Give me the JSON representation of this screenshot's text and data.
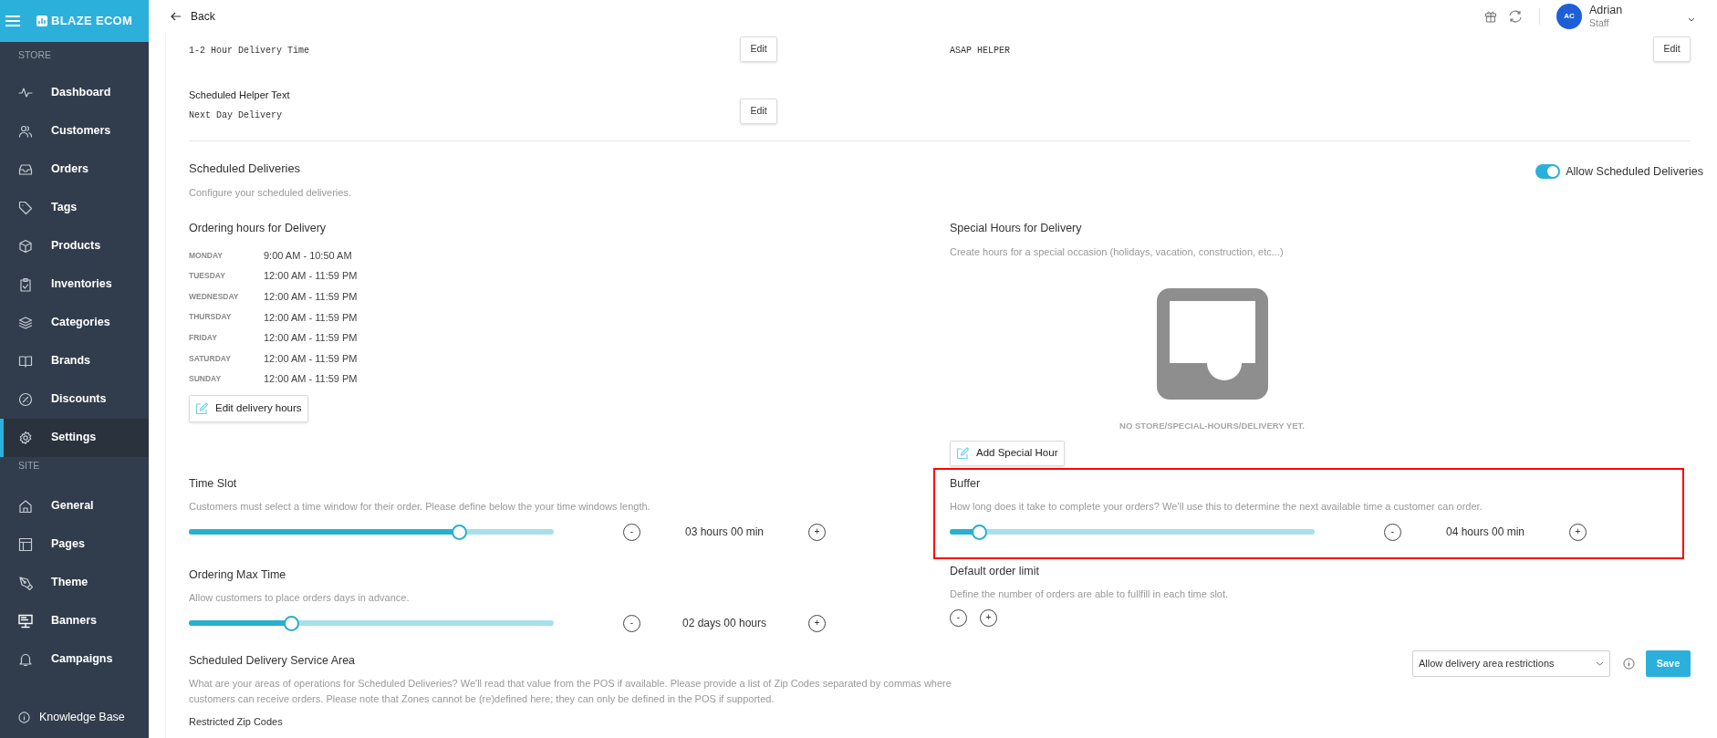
{
  "brand": {
    "name": "BLAZE ECOM"
  },
  "sidebar": {
    "sections": [
      {
        "label": "STORE",
        "items": [
          {
            "label": "Dashboard",
            "selected": false
          },
          {
            "label": "Customers",
            "selected": false
          },
          {
            "label": "Orders",
            "selected": false
          },
          {
            "label": "Tags",
            "selected": false
          },
          {
            "label": "Products",
            "selected": false
          },
          {
            "label": "Inventories",
            "selected": false
          },
          {
            "label": "Categories",
            "selected": false
          },
          {
            "label": "Brands",
            "selected": false
          },
          {
            "label": "Discounts",
            "selected": false
          },
          {
            "label": "Settings",
            "selected": true
          }
        ]
      },
      {
        "label": "SITE",
        "items": [
          {
            "label": "General",
            "selected": false
          },
          {
            "label": "Pages",
            "selected": false
          },
          {
            "label": "Theme",
            "selected": false
          },
          {
            "label": "Banners",
            "selected": false
          },
          {
            "label": "Campaigns",
            "selected": false
          }
        ]
      }
    ],
    "footer": {
      "label": "Knowledge Base"
    }
  },
  "header": {
    "back": "Back",
    "user": {
      "initials": "AC",
      "name": "Adrian",
      "role": "Staff"
    }
  },
  "helper_fields": [
    {
      "value": "1-2 Hour Delivery Time",
      "button": "Edit"
    },
    {
      "value": "ASAP HELPER",
      "button": "Edit"
    },
    {
      "label": "Scheduled Helper Text",
      "value": "Next Day Delivery",
      "button": "Edit"
    }
  ],
  "scheduled": {
    "title": "Scheduled Deliveries",
    "description": "Configure your scheduled deliveries.",
    "toggle": {
      "label": "Allow Scheduled Deliveries",
      "on": true
    }
  },
  "ordering_hours": {
    "title": "Ordering hours for Delivery",
    "rows": [
      {
        "day": "MONDAY",
        "hours": "9:00 AM - 10:50 AM"
      },
      {
        "day": "TUESDAY",
        "hours": "12:00 AM - 11:59 PM"
      },
      {
        "day": "WEDNESDAY",
        "hours": "12:00 AM - 11:59 PM"
      },
      {
        "day": "THURSDAY",
        "hours": "12:00 AM - 11:59 PM"
      },
      {
        "day": "FRIDAY",
        "hours": "12:00 AM - 11:59 PM"
      },
      {
        "day": "SATURDAY",
        "hours": "12:00 AM - 11:59 PM"
      },
      {
        "day": "SUNDAY",
        "hours": "12:00 AM - 11:59 PM"
      }
    ],
    "button": "Edit delivery hours"
  },
  "special_hours": {
    "title": "Special Hours for Delivery",
    "description": "Create hours for a special occasion (holidays, vacation, construction, etc...)",
    "empty_text": "NO STORE/SPECIAL-HOURS/DELIVERY YET.",
    "button": "Add Special Hour"
  },
  "time_slot": {
    "title": "Time Slot",
    "description": "Customers must select a time window for their order. Please define below the your time windows length.",
    "level": 0.74,
    "reading": "03 hours 00 min",
    "decrement": "-",
    "increment": "+"
  },
  "buffer": {
    "title": "Buffer",
    "description": "How long does it take to complete your orders? We’ll use this to determine the next available time a customer can order.",
    "level": 0.08,
    "reading": "04 hours 00 min",
    "decrement": "-",
    "increment": "+",
    "highlighted": true
  },
  "max_time": {
    "title": "Ordering Max Time",
    "description": "Allow customers to place orders days in advance.",
    "level": 0.28,
    "reading": "02 days 00 hours",
    "decrement": "-",
    "increment": "+"
  },
  "order_limit": {
    "title": "Default order limit",
    "description": "Define the number of orders are able to fullfill in each time slot.",
    "decrement": "-",
    "increment": "+"
  },
  "service_area": {
    "title": "Scheduled Delivery Service Area",
    "description": "What are your areas of operations for Scheduled Deliveries? We'll read that value from the POS if available. Please provide a list of Zip Codes separated by commas where customers can receive orders. Please note that Zones cannot be (re)defined here; they can only be defined in the POS if supported.",
    "select": "Allow delivery area restrictions",
    "button": "Save"
  },
  "restricted_label": "Restricted Zip Codes"
}
